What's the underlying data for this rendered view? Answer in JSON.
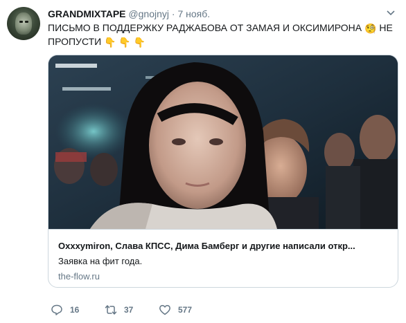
{
  "tweet": {
    "author_name": "GRANDMIXTAPE",
    "author_handle": "@gnojnyj",
    "separator": "·",
    "date": "7 нояб.",
    "text_main": "ПИСЬМО В ПОДДЕРЖКУ РАДЖАБОВА ОТ ЗАМАЯ И ОКСИМИРОНА",
    "text_tail": "НЕ ПРОПУСТИ",
    "emoji": {
      "magnifier": "🧐",
      "pointing_down": "👇"
    }
  },
  "card": {
    "title": "Oxxxymiron, Слава КПСС, Дима Бамберг и другие написали откр...",
    "description": "Заявка на фит года.",
    "domain": "the-flow.ru"
  },
  "actions": {
    "replies": "16",
    "retweets": "37",
    "likes": "577"
  },
  "colors": {
    "text": "#14171a",
    "secondary": "#657786",
    "border": "#ccd6dd"
  }
}
